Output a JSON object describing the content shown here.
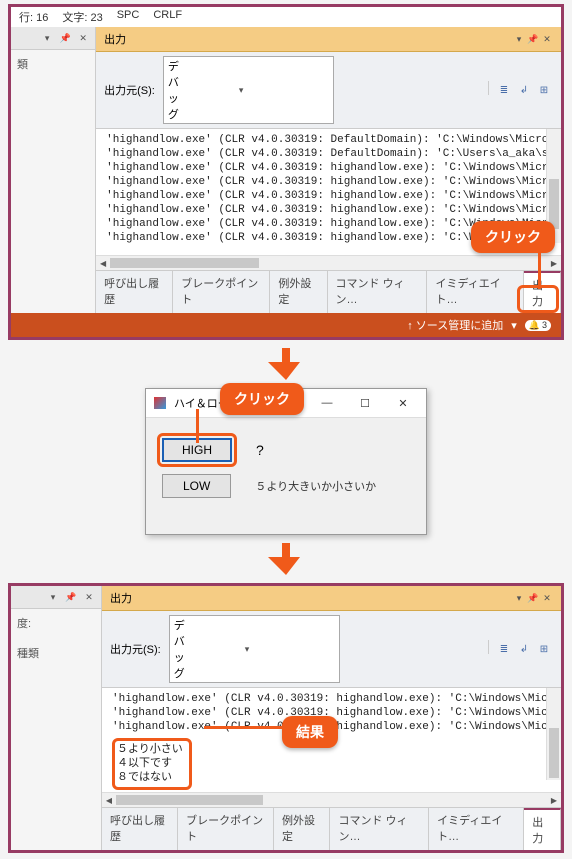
{
  "status": {
    "row": "行: 16",
    "chars": "文字: 23",
    "spc": "SPC",
    "crlf": "CRLF"
  },
  "output_panel": {
    "title": "出力",
    "source_label": "出力元(S):",
    "source_value": "デバッグ"
  },
  "out1_lines": [
    "'highandlow.exe' (CLR v4.0.30319: DefaultDomain): 'C:\\Windows\\Micros",
    "'highandlow.exe' (CLR v4.0.30319: DefaultDomain): 'C:\\Users\\a_aka\\s",
    "'highandlow.exe' (CLR v4.0.30319: highandlow.exe): 'C:\\Windows\\Micr",
    "'highandlow.exe' (CLR v4.0.30319: highandlow.exe): 'C:\\Windows\\Micr",
    "'highandlow.exe' (CLR v4.0.30319: highandlow.exe): 'C:\\Windows\\Micr",
    "'highandlow.exe' (CLR v4.0.30319: highandlow.exe): 'C:\\Windows\\Micr",
    "'highandlow.exe' (CLR v4.0.30319: highandlow.exe): 'C:\\Windows\\Micr",
    "'highandlow.exe' (CLR v4.0.30319: highandlow.exe): 'C:\\Windows\\Micr"
  ],
  "tabs": {
    "t0": "呼び出し履歴",
    "t1": "ブレークポイント",
    "t2": "例外設定",
    "t3": "コマンド ウィン…",
    "t4": "イミディエイト…",
    "t5": "出力"
  },
  "vs_status": {
    "add": "↑ ソース管理に追加",
    "bell": "3"
  },
  "callouts": {
    "click": "クリック",
    "result": "結果"
  },
  "dlg": {
    "title": "ハイ＆ロー",
    "high": "HIGH",
    "low": "LOW",
    "q": "?",
    "hint": "５より大きいか小さいか"
  },
  "left": {
    "kinds": "類",
    "deg": "度:",
    "types": "種類"
  },
  "out2_lines": [
    "'highandlow.exe' (CLR v4.0.30319: highandlow.exe): 'C:\\Windows\\Micr",
    "'highandlow.exe' (CLR v4.0.30319: highandlow.exe): 'C:\\Windows\\Micr",
    "'highandlow.exe' (CLR v4.0.30319: highandlow.exe): 'C:\\Windows\\Micr"
  ],
  "result": {
    "r0": "５より小さい",
    "r1": "４以下です",
    "r2": "８ではない"
  }
}
